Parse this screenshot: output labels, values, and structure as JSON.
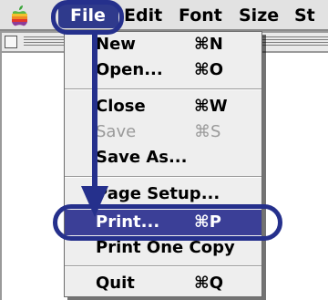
{
  "menubar": {
    "items": [
      {
        "label": "File",
        "selected": true
      },
      {
        "label": "Edit"
      },
      {
        "label": "Font"
      },
      {
        "label": "Size"
      },
      {
        "label": "St"
      }
    ]
  },
  "file_menu": {
    "items": [
      {
        "label": "New",
        "shortcut": "⌘N",
        "enabled": true
      },
      {
        "label": "Open...",
        "shortcut": "⌘O",
        "enabled": true
      },
      {
        "label": "Close",
        "shortcut": "⌘W",
        "enabled": true
      },
      {
        "label": "Save",
        "shortcut": "⌘S",
        "enabled": false
      },
      {
        "label": "Save As...",
        "shortcut": "",
        "enabled": true
      },
      {
        "label": "Page Setup...",
        "shortcut": "",
        "enabled": true
      },
      {
        "label": "Print...",
        "shortcut": "⌘P",
        "enabled": true,
        "highlighted": true
      },
      {
        "label": "Print One Copy",
        "shortcut": "",
        "enabled": true
      },
      {
        "label": "Quit",
        "shortcut": "⌘Q",
        "enabled": true
      }
    ]
  },
  "colors": {
    "highlight": "#3b3f97",
    "annotation": "#25308c"
  }
}
